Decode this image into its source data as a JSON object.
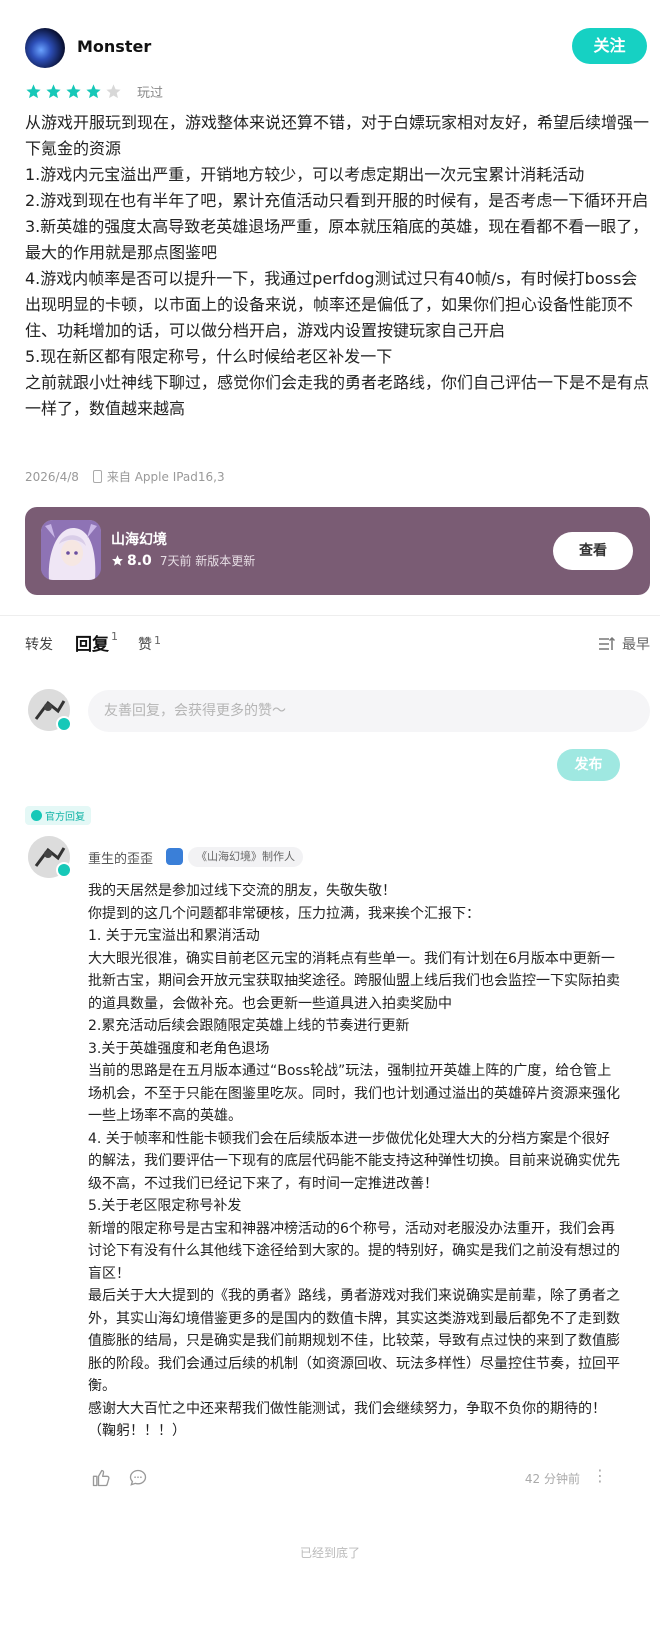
{
  "review": {
    "username": "Monster",
    "follow_label": "关注",
    "rating": 4,
    "rating_max": 5,
    "played_label": "玩过",
    "paragraphs": [
      "从游戏开服玩到现在，游戏整体来说还算不错，对于白嫖玩家相对友好，希望后续增强一下氪金的资源",
      "1.游戏内元宝溢出严重，开销地方较少，可以考虑定期出一次元宝累计消耗活动",
      "2.游戏到现在也有半年了吧，累计充值活动只看到开服的时候有，是否考虑一下循环开启",
      "3.新英雄的强度太高导致老英雄退场严重，原本就压箱底的英雄，现在看都不看一眼了，最大的作用就是那点图鉴吧",
      "4.游戏内帧率是否可以提升一下，我通过perfdog测试过只有40帧/s，有时候打boss会出现明显的卡顿，以市面上的设备来说，帧率还是偏低了，如果你们担心设备性能顶不住、功耗增加的话，可以做分档开启，游戏内设置按键玩家自己开启",
      "5.现在新区都有限定称号，什么时候给老区补发一下",
      "之前就跟小灶神线下聊过，感觉你们会走我的勇者老路线，你们自己评估一下是不是有点一样了，数值越来越高"
    ],
    "date": "2026/4/8",
    "device": "来自 Apple IPad16,3"
  },
  "game_card": {
    "name": "山海幻境",
    "score": "8.0",
    "update_text": "7天前 新版本更新",
    "view_label": "查看"
  },
  "tabs": {
    "repost": "转发",
    "reply": "回复",
    "reply_count": "1",
    "like": "赞",
    "like_count": "1",
    "sort": "最早"
  },
  "reply_box": {
    "placeholder": "友善回复，会获得更多的赞～",
    "publish_label": "发布"
  },
  "official_reply": {
    "tag": "官方回复",
    "name": "重生的歪歪",
    "role": "《山海幻境》制作人",
    "paragraphs": [
      "我的天居然是参加过线下交流的朋友，失敬失敬！",
      "你提到的这几个问题都非常硬核，压力拉满，我来挨个汇报下：",
      "1. 关于元宝溢出和累消活动",
      "大大眼光很准，确实目前老区元宝的消耗点有些单一。我们有计划在6月版本中更新一批新古宝，期间会开放元宝获取抽奖途径。跨服仙盟上线后我们也会监控一下实际拍卖的道具数量，会做补充。也会更新一些道具进入拍卖奖励中",
      "2.累充活动后续会跟随限定英雄上线的节奏进行更新",
      "3.关于英雄强度和老角色退场",
      "当前的思路是在五月版本通过“Boss轮战”玩法，强制拉开英雄上阵的广度，给仓管上场机会，不至于只能在图鉴里吃灰。同时，我们也计划通过溢出的英雄碎片资源来强化一些上场率不高的英雄。",
      "4. 关于帧率和性能卡顿我们会在后续版本进一步做优化处理大大的分档方案是个很好的解法，我们要评估一下现有的底层代码能不能支持这种弹性切换。目前来说确实优先级不高，不过我们已经记下来了，有时间一定推进改善！",
      "5.关于老区限定称号补发",
      "新增的限定称号是古宝和神器冲榜活动的6个称号，活动对老服没办法重开，我们会再讨论下有没有什么其他线下途径给到大家的。提的特别好，确实是我们之前没有想过的盲区！",
      "最后关于大大提到的《我的勇者》路线，勇者游戏对我们来说确实是前辈，除了勇者之外，其实山海幻境借鉴更多的是国内的数值卡牌，其实这类游戏到最后都免不了走到数值膨胀的结局，只是确实是我们前期规划不佳，比较菜，导致有点过快的来到了数值膨胀的阶段。我们会通过后续的机制（如资源回收、玩法多样性）尽量控住节奏，拉回平衡。",
      "感谢大大百忙之中还来帮我们做性能测试，我们会继续努力，争取不负你的期待的！（鞠躬！！！）"
    ],
    "time": "42 分钟前"
  },
  "bottom_note": "已经到底了",
  "icons": {
    "star": "star-icon",
    "device": "tablet-icon",
    "sort": "sort-icon",
    "like": "thumb-up-icon",
    "comment": "comment-icon",
    "more": "more-vertical-icon"
  },
  "colors": {
    "accent": "#16d1c3",
    "star_on": "#16c8b8",
    "star_off": "#d8d8d8",
    "card_bg": "#7a5c74"
  }
}
